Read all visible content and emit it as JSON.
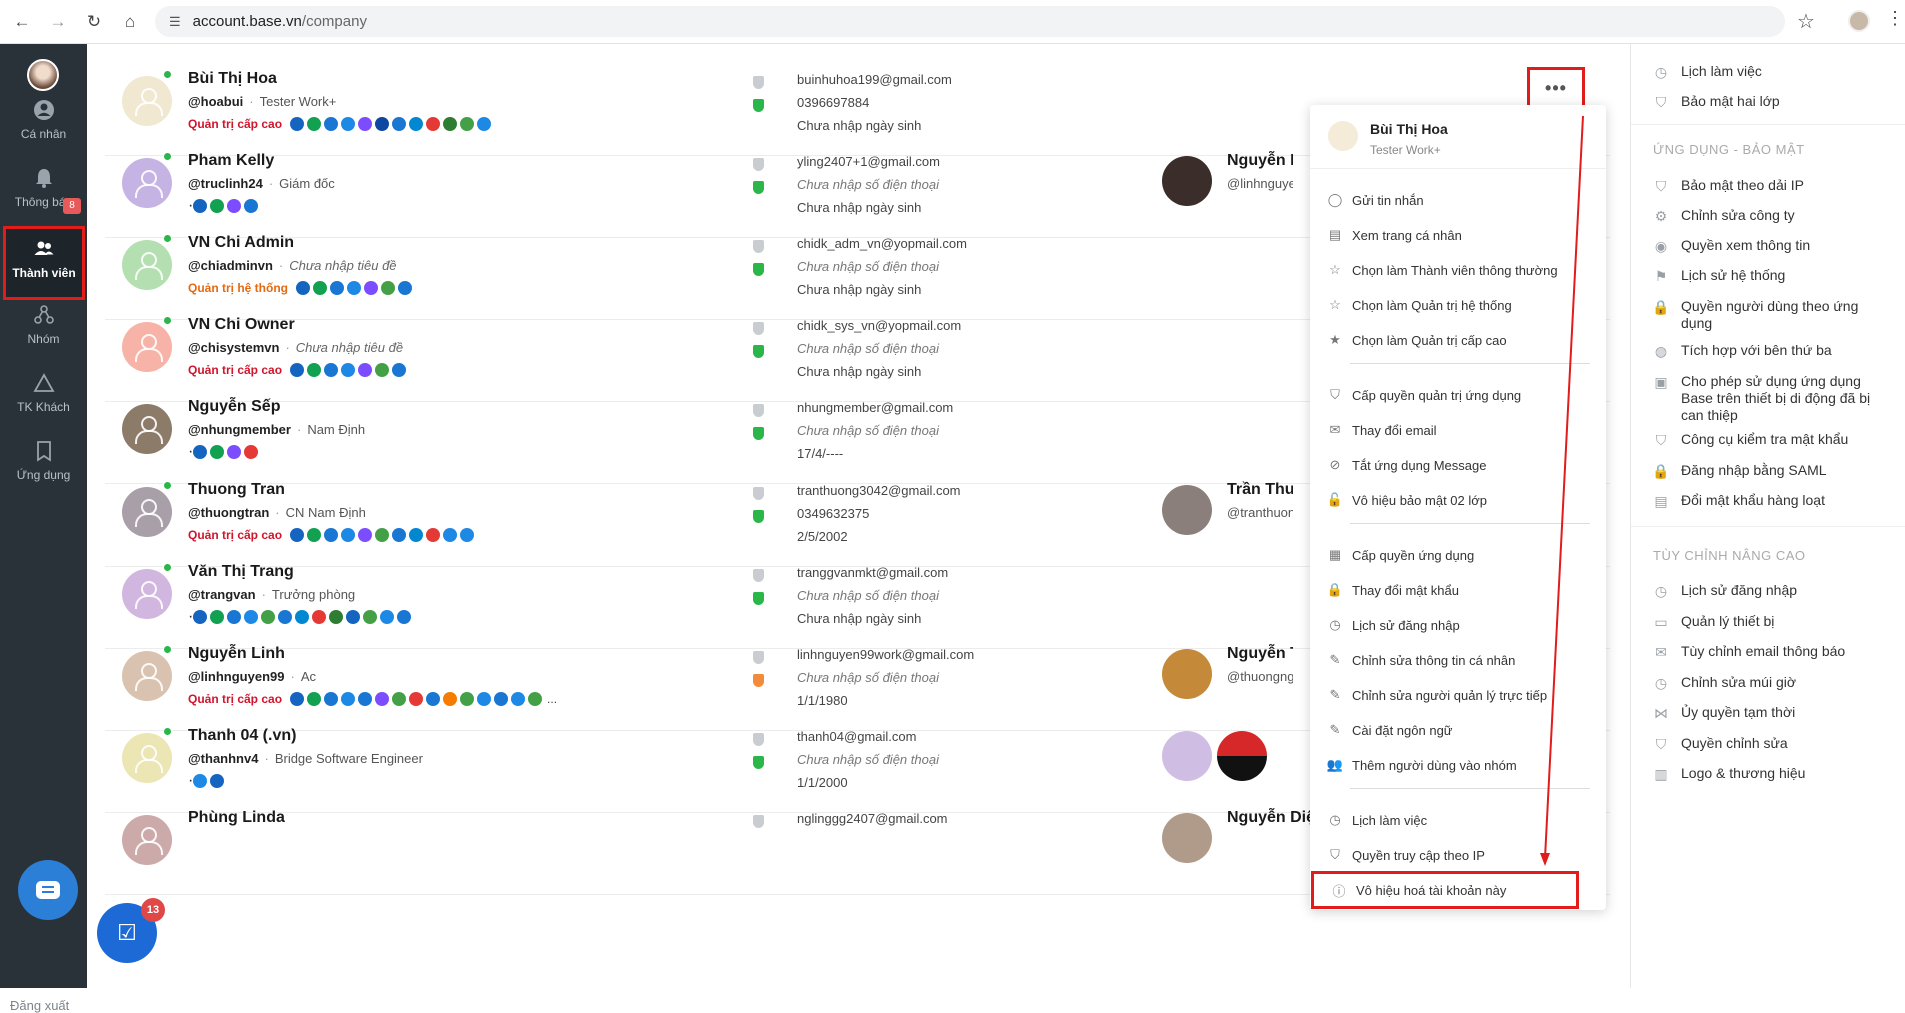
{
  "browser": {
    "url_host": "account.base.vn",
    "url_path": "/company"
  },
  "sidebar": {
    "items": [
      {
        "label": "Cá nhân",
        "icon": "user-icon"
      },
      {
        "label": "Thông báo",
        "icon": "bell-icon",
        "badge": "8"
      },
      {
        "label": "Thành viên",
        "icon": "members-icon",
        "active": true
      },
      {
        "label": "Nhóm",
        "icon": "group-icon"
      },
      {
        "label": "TK Khách",
        "icon": "guest-icon"
      },
      {
        "label": "Ứng dụng",
        "icon": "apps-icon"
      }
    ],
    "logout_label": "Đăng xuất",
    "task_badge": "13"
  },
  "members": [
    {
      "name": "Bùi Thị Hoa",
      "handle": "@hoabui",
      "title": "Tester Work+",
      "role": "Quản trị cấp cao",
      "role_type": "high",
      "email": "buinhuhoa199@gmail.com",
      "phone": "0396697884",
      "birth": "Chưa nhập ngày sinh",
      "avatar_color": "#f1e8d2",
      "apps": [
        "#1565c0",
        "#12a150",
        "#1976d2",
        "#1e88e5",
        "#7c4dff",
        "#0d47a1",
        "#1976d2",
        "#0288d1",
        "#e53935",
        "#2e7d32",
        "#43a047",
        "#1e88e5"
      ]
    },
    {
      "name": "Pham Kelly",
      "handle": "@truclinh24",
      "title": "Giám đốc",
      "role": "",
      "email": "yling2407+1@gmail.com",
      "phone": "Chưa nhập số điện thoại",
      "birth": "Chưa nhập ngày sinh",
      "avatar_color": "#c5b3e3",
      "apps": [
        "#1565c0",
        "#12a150",
        "#7c4dff",
        "#1976d2"
      ],
      "manager": {
        "name": "Nguyễn Di",
        "handle": "@linhnguyer"
      }
    },
    {
      "name": "VN Chi Admin",
      "handle": "@chiadminvn",
      "title": "Chưa nhập tiêu đề",
      "title_empty": true,
      "role": "Quản trị hệ thống",
      "role_type": "sys",
      "email": "chidk_adm_vn@yopmail.com",
      "phone": "Chưa nhập số điện thoại",
      "birth": "Chưa nhập ngày sinh",
      "avatar_color": "#b4dfb1",
      "apps": [
        "#1565c0",
        "#12a150",
        "#1976d2",
        "#1e88e5",
        "#7c4dff",
        "#43a047",
        "#1976d2"
      ]
    },
    {
      "name": "VN Chi Owner",
      "handle": "@chisystemvn",
      "title": "Chưa nhập tiêu đề",
      "title_empty": true,
      "role": "Quản trị cấp cao",
      "role_type": "high",
      "email": "chidk_sys_vn@yopmail.com",
      "phone": "Chưa nhập số điện thoại",
      "birth": "Chưa nhập ngày sinh",
      "avatar_color": "#f7b3a7",
      "apps": [
        "#1565c0",
        "#12a150",
        "#1976d2",
        "#1e88e5",
        "#7c4dff",
        "#43a047",
        "#1976d2"
      ]
    },
    {
      "name": "Nguyễn Sếp",
      "handle": "@nhungmember",
      "title": "Nam Định",
      "role": "",
      "email": "nhungmember@gmail.com",
      "phone": "Chưa nhập số điện thoại",
      "birth": "17/4/----",
      "avatar_color": "#8d7b6a",
      "apps": [
        "#1565c0",
        "#12a150",
        "#7c4dff",
        "#e53935"
      ]
    },
    {
      "name": "Thuong Tran",
      "handle": "@thuongtran",
      "title": "CN Nam Định",
      "role": "Quản trị cấp cao",
      "role_type": "high",
      "email": "tranthuong3042@gmail.com",
      "phone": "0349632375",
      "birth": "2/5/2002",
      "avatar_color": "#a99fa8",
      "apps": [
        "#1565c0",
        "#12a150",
        "#1976d2",
        "#1e88e5",
        "#7c4dff",
        "#43a047",
        "#1976d2",
        "#0288d1",
        "#e53935",
        "#1e88e5",
        "#1e88e5"
      ],
      "manager": {
        "name": "Trần Thươ",
        "handle": "@tranthuong"
      }
    },
    {
      "name": "Văn Thị Trang",
      "handle": "@trangvan",
      "title": "Trưởng phòng",
      "role": "",
      "email": "tranggvanmkt@gmail.com",
      "phone": "Chưa nhập số điện thoại",
      "birth": "Chưa nhập ngày sinh",
      "avatar_color": "#d1b7e0",
      "apps": [
        "#1565c0",
        "#12a150",
        "#1976d2",
        "#1e88e5",
        "#43a047",
        "#1976d2",
        "#0288d1",
        "#e53935",
        "#2e7d32",
        "#1565c0",
        "#43a047",
        "#1e88e5",
        "#1976d2"
      ]
    },
    {
      "name": "Nguyễn Linh",
      "handle": "@linhnguyen99",
      "title": "Ac",
      "role": "Quản trị cấp cao",
      "role_type": "high",
      "email": "linhnguyen99work@gmail.com",
      "phone": "Chưa nhập số điện thoại",
      "birth": "1/1/1980",
      "avatar_color": "#d9c3b0",
      "apps": [
        "#1565c0",
        "#12a150",
        "#1976d2",
        "#1e88e5",
        "#1976d2",
        "#7c4dff",
        "#43a047",
        "#e53935",
        "#1976d2",
        "#f57c00",
        "#43a047",
        "#1e88e5",
        "#1976d2",
        "#1e88e5",
        "#43a047"
      ],
      "more_apps": "...",
      "manager": {
        "name": "Nguyễn Th",
        "handle": "@thuongngu"
      }
    },
    {
      "name": "Thanh 04 (.vn)",
      "handle": "@thanhnv4",
      "title": "Bridge Software Engineer",
      "role": "",
      "email": "thanh04@gmail.com",
      "phone": "Chưa nhập số điện thoại",
      "birth": "1/1/2000",
      "avatar_color": "#ece5b4",
      "apps": [
        "#1e88e5",
        "#1565c0"
      ]
    },
    {
      "name": "Phùng Linda",
      "handle": "",
      "title": "",
      "role": "",
      "email": "nglinggg2407@gmail.com",
      "phone": "",
      "birth": "",
      "avatar_color": "#caa",
      "apps": [],
      "manager": {
        "name": "Nguyễn Diệp Linh Chi",
        "handle": ""
      }
    }
  ],
  "dropdown": {
    "name": "Bùi Thị Hoa",
    "role": "Tester Work+",
    "items": [
      {
        "label": "Gửi tin nhắn",
        "icon": "message-icon"
      },
      {
        "label": "Xem trang cá nhân",
        "icon": "profile-icon"
      },
      {
        "label": "Chọn làm Thành viên thông thường",
        "icon": "star-outline-icon"
      },
      {
        "label": "Chọn làm Quản trị hệ thống",
        "icon": "star-outline-icon"
      },
      {
        "label": "Chọn làm Quản trị cấp cao",
        "icon": "star-icon"
      },
      {
        "label": "Cấp quyền quản trị ứng dụng",
        "icon": "shield-icon"
      },
      {
        "label": "Thay đổi email",
        "icon": "envelope-icon"
      },
      {
        "label": "Tắt ứng dụng Message",
        "icon": "block-icon"
      },
      {
        "label": "Vô hiệu bảo mật 02 lớp",
        "icon": "unlock-icon"
      },
      {
        "label": "Cấp quyền ứng dụng",
        "icon": "apps-icon"
      },
      {
        "label": "Thay đổi mật khẩu",
        "icon": "lock-icon"
      },
      {
        "label": "Lịch sử đăng nhập",
        "icon": "clock-icon"
      },
      {
        "label": "Chỉnh sửa thông tin cá nhân",
        "icon": "pencil-icon"
      },
      {
        "label": "Chỉnh sửa người quản lý trực tiếp",
        "icon": "pencil-icon"
      },
      {
        "label": "Cài đặt ngôn ngữ",
        "icon": "pencil-icon"
      },
      {
        "label": "Thêm người dùng vào nhóm",
        "icon": "users-icon"
      },
      {
        "label": "Lịch làm việc",
        "icon": "clock-icon"
      },
      {
        "label": "Quyền truy cập theo IP",
        "icon": "shield-icon"
      },
      {
        "label": "Vô hiệu hoá tài khoản này",
        "icon": "warning-icon"
      }
    ]
  },
  "right_panel": {
    "top_items": [
      {
        "label": "Lịch làm việc",
        "icon": "clock-icon"
      },
      {
        "label": "Bảo mật hai lớp",
        "icon": "shield-icon"
      }
    ],
    "section_security": "ỨNG DỤNG - BẢO MẬT",
    "security_items": [
      {
        "label": "Bảo mật theo dải IP",
        "icon": "shield-icon"
      },
      {
        "label": "Chỉnh sửa công ty",
        "icon": "gear-icon"
      },
      {
        "label": "Quyền xem thông tin",
        "icon": "eye-icon"
      },
      {
        "label": "Lịch sử hệ thống",
        "icon": "flag-icon"
      },
      {
        "label": "Quyền người dùng theo ứng dụng",
        "icon": "lock-icon"
      },
      {
        "label": "Tích hợp với bên thứ ba",
        "icon": "globe-icon"
      },
      {
        "label": "Cho phép sử dụng ứng dụng Base trên thiết bị di động đã bị can thiệp",
        "icon": "android-icon"
      },
      {
        "label": "Công cụ kiểm tra mật khẩu",
        "icon": "shield-icon"
      },
      {
        "label": "Đăng nhập bằng SAML",
        "icon": "lock-icon"
      },
      {
        "label": "Đổi mật khẩu hàng loạt",
        "icon": "id-card-icon"
      }
    ],
    "section_advanced": "TÙY CHỈNH NÂNG CAO",
    "advanced_items": [
      {
        "label": "Lịch sử đăng nhập",
        "icon": "clock-icon"
      },
      {
        "label": "Quản lý thiết bị",
        "icon": "monitor-icon"
      },
      {
        "label": "Tùy chỉnh email thông báo",
        "icon": "envelope-icon"
      },
      {
        "label": "Chỉnh sửa múi giờ",
        "icon": "clock-icon"
      },
      {
        "label": "Ủy quyền tạm thời",
        "icon": "share-icon"
      },
      {
        "label": "Quyền chỉnh sửa",
        "icon": "shield-icon"
      },
      {
        "label": "Logo & thương hiệu",
        "icon": "chart-icon"
      }
    ]
  },
  "colors": {
    "accent_red": "#e21b1b",
    "sidebar_bg": "#293139",
    "role_high": "#d0152c",
    "role_sys": "#e46a12",
    "online": "#2bb64a",
    "verified_green": "#2bb64a"
  }
}
